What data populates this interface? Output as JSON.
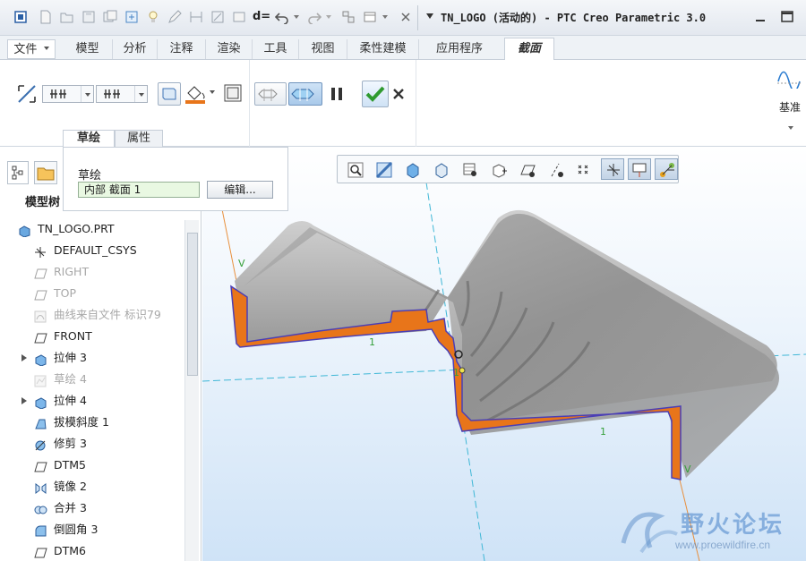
{
  "window": {
    "title": "TN_LOGO (活动的) - PTC Creo Parametric 3.0"
  },
  "quick_access": {
    "icons": [
      "window-icon",
      "new-icon",
      "open-icon",
      "save-icon",
      "save-copy-icon",
      "regenerate-icon",
      "bulb-icon",
      "edit-icon",
      "dimension-icon",
      "sketch-icon",
      "relation-icon",
      "undo-icon",
      "redo-icon",
      "windows-icon",
      "close-window-icon"
    ],
    "relations_label": "d="
  },
  "menu_tabs": [
    {
      "label": "文件",
      "dropdown": true
    },
    {
      "label": "模型"
    },
    {
      "label": "分析"
    },
    {
      "label": "注释"
    },
    {
      "label": "渲染"
    },
    {
      "label": "工具"
    },
    {
      "label": "视图"
    },
    {
      "label": "柔性建模"
    },
    {
      "label": "应用程序"
    },
    {
      "label": "截面",
      "active": true
    }
  ],
  "ribbon": {
    "datum_label": "基准",
    "icons": [
      "flip-section-icon",
      "offset-dropdown-icon",
      "offset-dropdown-icon",
      "show-section-icon",
      "color-fill-icon",
      "hatch-icon",
      "preview-icon",
      "preview-section-icon",
      "pause-icon",
      "apply-check-icon",
      "cancel-x-icon"
    ]
  },
  "dashboard": {
    "tabs": [
      {
        "label": "草绘",
        "active": true
      },
      {
        "label": "属性"
      }
    ],
    "sketch_label": "草绘",
    "sketch_value": "内部 截面 1",
    "edit_button": "编辑..."
  },
  "tree": {
    "tab_label": "模型树",
    "items": [
      {
        "label": "TN_LOGO.PRT",
        "icon": "part-icon",
        "dim": false,
        "expand": false,
        "indent": 0
      },
      {
        "label": "DEFAULT_CSYS",
        "icon": "csys-icon",
        "dim": false,
        "expand": false,
        "indent": 1
      },
      {
        "label": "RIGHT",
        "icon": "plane-icon",
        "dim": true,
        "expand": false,
        "indent": 1
      },
      {
        "label": "TOP",
        "icon": "plane-icon",
        "dim": true,
        "expand": false,
        "indent": 1
      },
      {
        "label": "曲线来自文件 标识79",
        "icon": "curve-icon",
        "dim": true,
        "expand": false,
        "indent": 1
      },
      {
        "label": "FRONT",
        "icon": "plane-icon",
        "dim": false,
        "expand": false,
        "indent": 1
      },
      {
        "label": "拉伸 3",
        "icon": "extrude-icon",
        "dim": false,
        "expand": true,
        "indent": 1
      },
      {
        "label": "草绘 4",
        "icon": "sketch-icon",
        "dim": true,
        "expand": false,
        "indent": 1
      },
      {
        "label": "拉伸 4",
        "icon": "extrude-icon",
        "dim": false,
        "expand": true,
        "indent": 1
      },
      {
        "label": "拔模斜度 1",
        "icon": "draft-icon",
        "dim": false,
        "expand": false,
        "indent": 1
      },
      {
        "label": "修剪 3",
        "icon": "trim-icon",
        "dim": false,
        "expand": false,
        "indent": 1
      },
      {
        "label": "DTM5",
        "icon": "plane-icon",
        "dim": false,
        "expand": false,
        "indent": 1
      },
      {
        "label": "镜像 2",
        "icon": "mirror-icon",
        "dim": false,
        "expand": false,
        "indent": 1
      },
      {
        "label": "合并 3",
        "icon": "merge-icon",
        "dim": false,
        "expand": false,
        "indent": 1
      },
      {
        "label": "倒圆角 3",
        "icon": "round-icon",
        "dim": false,
        "expand": false,
        "indent": 1
      },
      {
        "label": "DTM6",
        "icon": "plane-icon",
        "dim": false,
        "expand": false,
        "indent": 1
      }
    ]
  },
  "view_toolbar": {
    "icons": [
      "zoom-icon",
      "zoom-fit-icon",
      "shading-icon",
      "saved-views-icon",
      "view-manager-icon",
      "perspective-icon",
      "datum-plane-display-icon",
      "datum-axis-display-icon",
      "point-display-icon",
      "csys-display-icon",
      "annotation-display-icon",
      "spin-center-icon"
    ],
    "active": [
      9,
      10,
      11
    ]
  },
  "watermark": {
    "logo_text": "野火论坛",
    "url": "www.proewildfire.cn"
  },
  "colors": {
    "section_fill": "#e8751a",
    "section_edge": "#4b3fb5",
    "part_gray": "#8f8f8f",
    "viewport_bottom": "#cfe3f7",
    "check_green": "#2f9a2f"
  }
}
